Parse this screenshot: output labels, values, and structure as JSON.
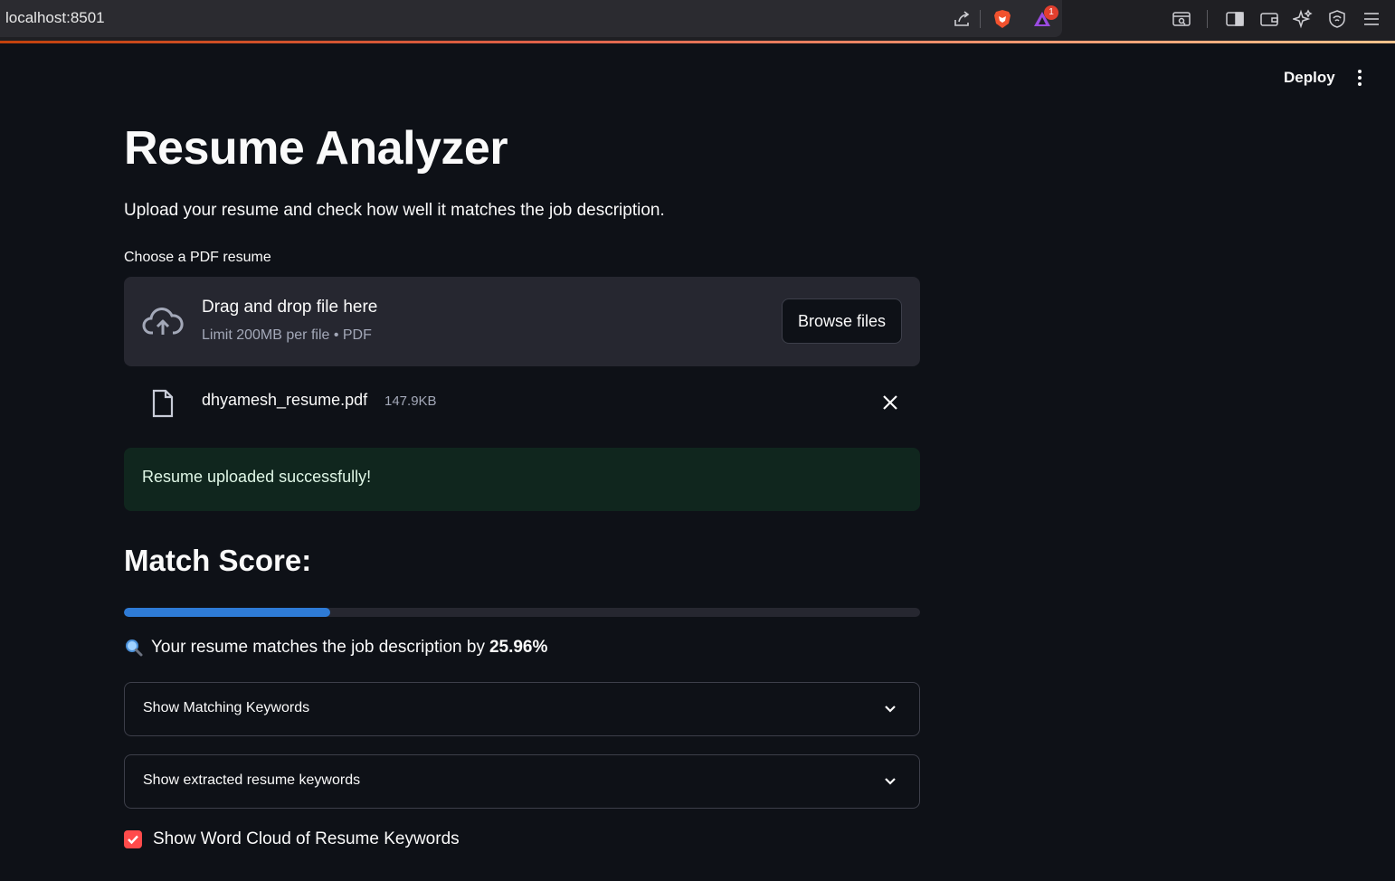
{
  "browser": {
    "url": "localhost:8501",
    "notification_count": "1"
  },
  "header": {
    "deploy_label": "Deploy"
  },
  "main": {
    "title": "Resume Analyzer",
    "subtitle": "Upload your resume and check how well it matches the job description.",
    "uploader": {
      "label": "Choose a PDF resume",
      "drag_text": "Drag and drop file here",
      "limit_text": "Limit 200MB per file • PDF",
      "browse_label": "Browse files"
    },
    "uploaded_file": {
      "name": "dhyamesh_resume.pdf",
      "size": "147.9KB"
    },
    "success_message": "Resume uploaded successfully!",
    "match": {
      "heading": "Match Score:",
      "progress_fraction": 0.2596,
      "text_prefix": "Your resume matches the job description by",
      "percent": "25.96%"
    },
    "expanders": [
      {
        "label": "Show Matching Keywords"
      },
      {
        "label": "Show extracted resume keywords"
      }
    ],
    "checkbox": {
      "label": "Show Word Cloud of Resume Keywords",
      "checked": true
    }
  },
  "colors": {
    "background": "#0e1117",
    "accent_blue": "#2e7bd6",
    "checkbox_red": "#ff4b4b",
    "success_bg": "#1f3a2b"
  }
}
